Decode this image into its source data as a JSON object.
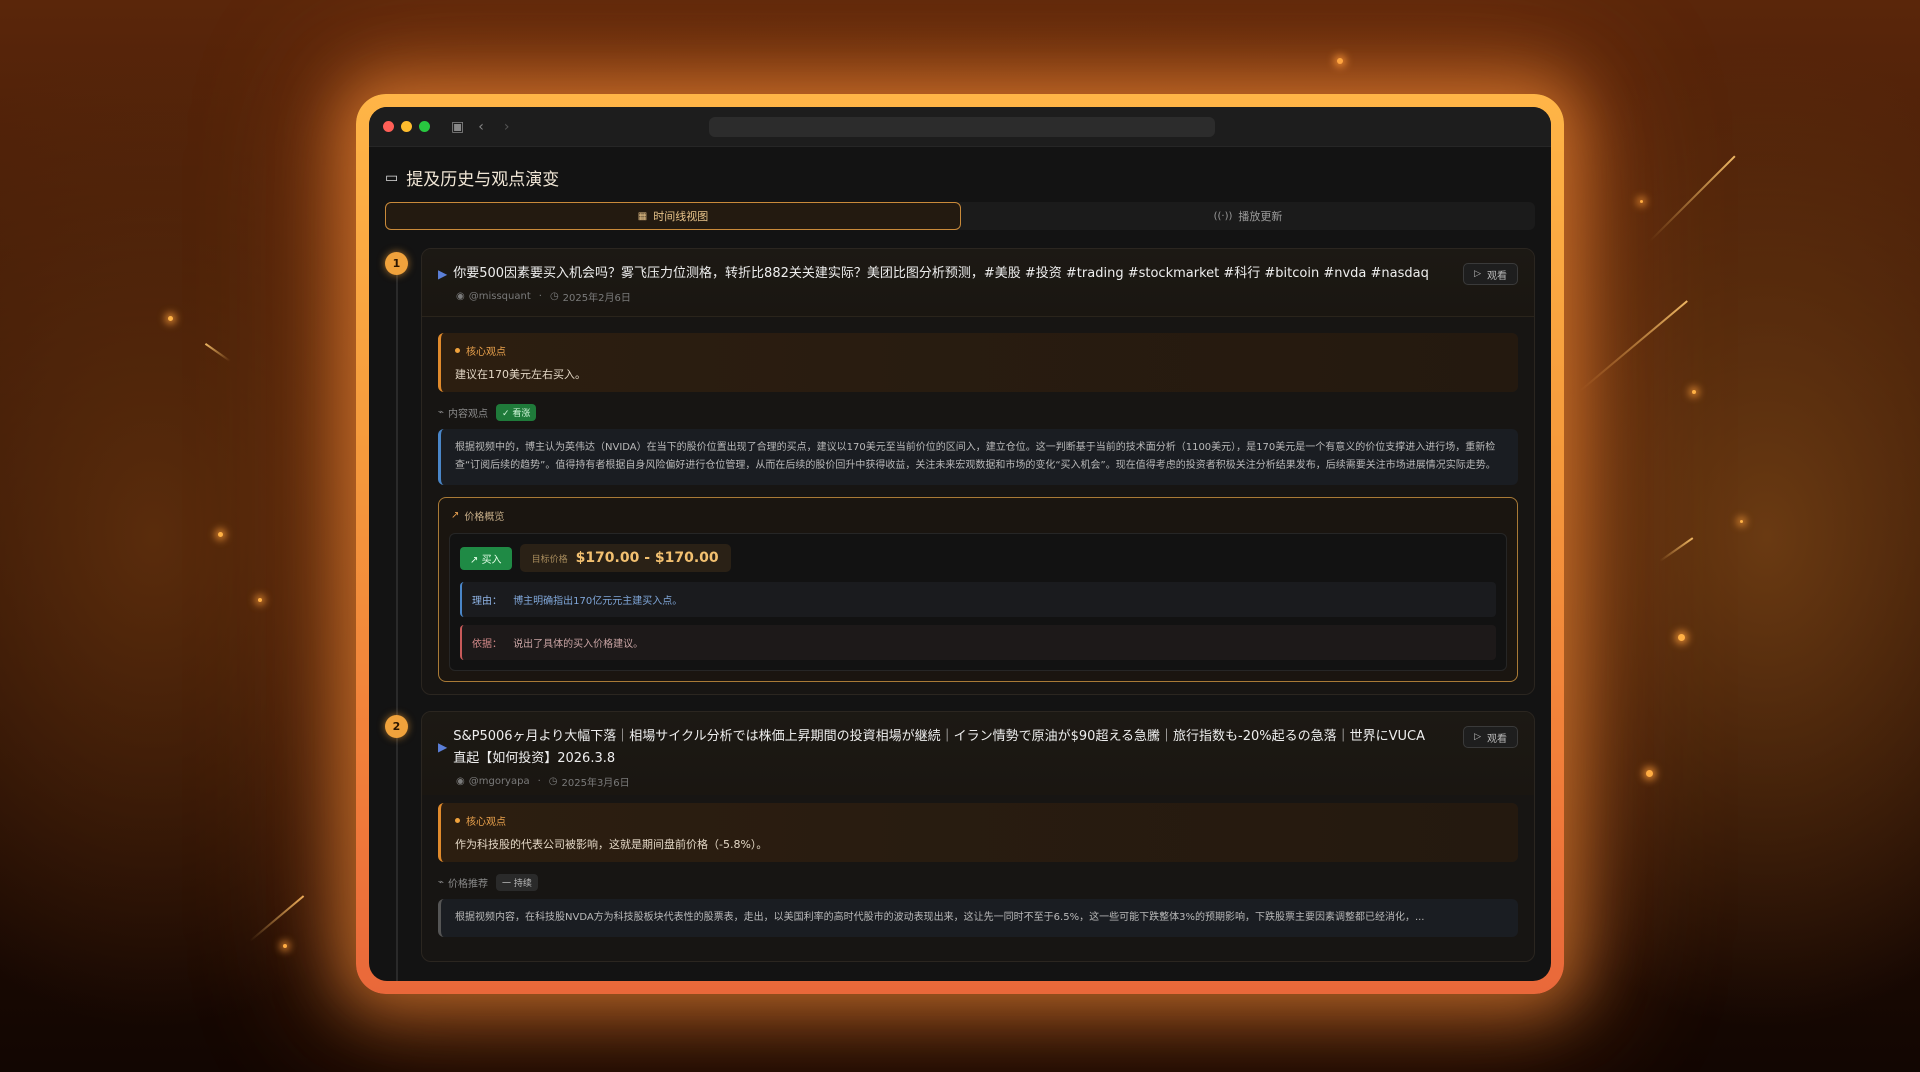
{
  "window": {
    "accent": "#f0a23c",
    "traffic_lights": [
      "#ff5f57",
      "#febc2e",
      "#28c840"
    ]
  },
  "page": {
    "title": "提及历史与观点演变",
    "tabs": [
      {
        "label": "时间线视图",
        "icon": "calendar-icon",
        "active": true
      },
      {
        "label": "播放更新",
        "icon": "broadcast-icon",
        "active": false
      }
    ]
  },
  "timeline": [
    {
      "index": "1",
      "title": "你要500因素要买入机会吗？雾飞压力位测格，转折比882关关建实际？美团比图分析预测，#美股 #投资 #trading #stockmarket #科行 #bitcoin #nvda #nasdaq",
      "author": "@missquant",
      "date": "2025年2月6日",
      "watch_label": "观看",
      "core_label": "核心观点",
      "core_text": "建议在170美元左右买入。",
      "content_label": "内容观点",
      "content_badge": "✓ 看涨",
      "quote": "根据视频中的，博主认为英伟达（NVIDA）在当下的股价位置出现了合理的买点，建议以170美元至当前价位的区间入，建立仓位。这一判断基于当前的技术面分析（1100美元），是170美元是一个有意义的价位支撑进入进行场，重新检查“订阅后续的趋势”。值得持有者根据自身风险偏好进行仓位管理，从而在后续的股价回升中获得收益，关注未来宏观数据和市场的变化“买入机会”。现在值得考虑的投资者积极关注分析结果发布，后续需要关注市场进展情况实际走势。",
      "price": {
        "label": "价格概览",
        "action": "买入",
        "range_label": "目标价格",
        "range": "$170.00 - $170.00",
        "reason_key": "理由：",
        "reason": "博主明确指出170亿元元主建买入点。",
        "basis_key": "依据：",
        "basis": "说出了具体的买入价格建议。"
      }
    },
    {
      "index": "2",
      "title": "S&P5006ヶ月より大幅下落｜相場サイクル分析では株価上昇期間の投資相場が継続｜イラン情勢で原油が$90超える急騰｜旅行指数も-20%起るの急落｜世界にVUCA直起【如何投资】2026.3.8",
      "author": "@mgoryapa",
      "date": "2025年3月6日",
      "watch_label": "观看",
      "core_label": "核心观点",
      "core_text": "作为科技股的代表公司被影响，这就是期间盘前价格（-5.8%）。",
      "content_label": "价格推荐",
      "content_badge": "一 持续",
      "quote": "根据视频内容，在科技股NVDA方为科技股板块代表性的股票表，走出，以美国利率的高时代股市的波动表现出来，这让先一同时不至于6.5%，这一些可能下跌整体3%的预期影响，下跌股票主要因素调整都已经消化，..."
    }
  ]
}
